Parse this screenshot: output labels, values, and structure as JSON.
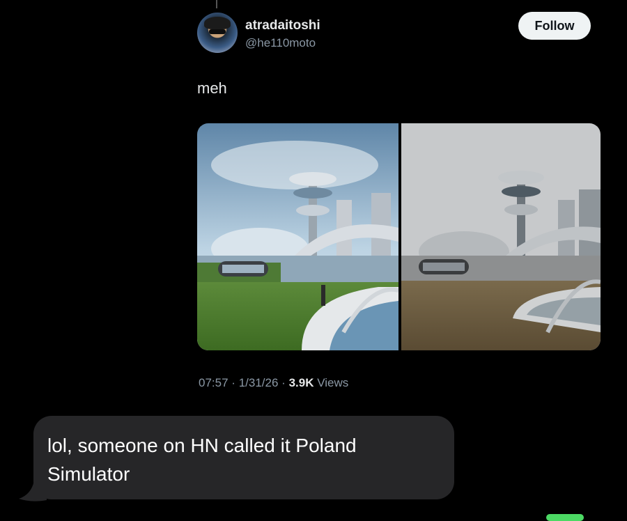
{
  "tweet": {
    "author_name": "atradaitoshi",
    "author_handle": "@he110moto",
    "follow_label": "Follow",
    "text": "meh",
    "time": "07:57",
    "date": "1/31/26",
    "views_count": "3.9K",
    "views_label": "Views",
    "separator": "·"
  },
  "message": {
    "line1": "lol, someone on HN called it Poland",
    "line2": "Simulator"
  },
  "colors": {
    "background": "#000000",
    "bubble": "#262628",
    "secondary_text": "#8b98a5",
    "follow_bg": "#eff3f4"
  }
}
